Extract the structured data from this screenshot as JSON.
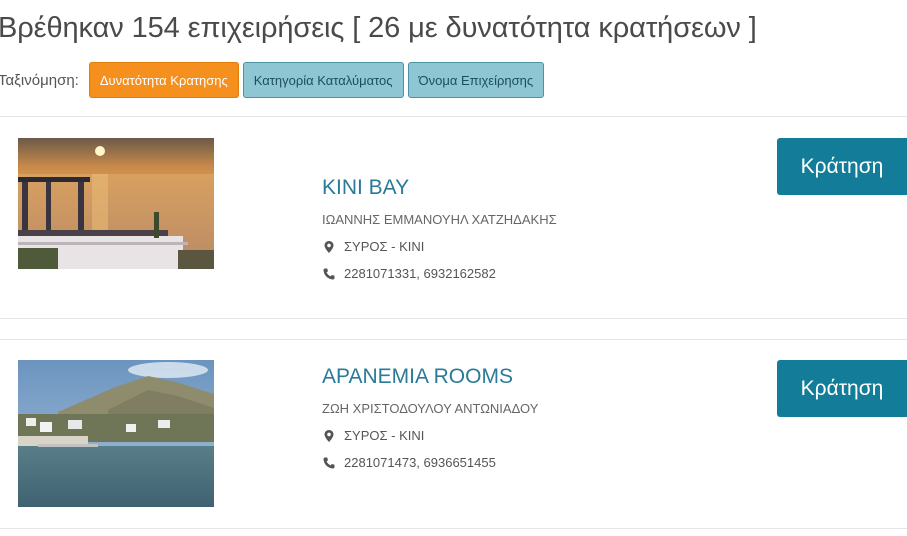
{
  "header": {
    "results_text": "Βρέθηκαν 154 επιχειρήσεις [ 26 με δυνατότητα κρατήσεων ]"
  },
  "sort": {
    "label": "Ταξινόμηση:",
    "options": [
      {
        "label": "Δυνατότητα Κρατησης",
        "active": true
      },
      {
        "label": "Κατηγορία Καταλύματος",
        "active": false
      },
      {
        "label": "Όνομα Επιχείρησης",
        "active": false
      }
    ]
  },
  "listings": [
    {
      "name": "KINI BAY",
      "owner": "ΙΩΑΝΝΗΣ ΕΜΜΑΝΟΥΗΛ ΧΑΤΖΗΔΑΚΗΣ",
      "location": "ΣΥΡΟΣ - ΚΙΝΙ",
      "phones": "2281071331, 6932162582",
      "book_label": "Κράτηση",
      "location_icon": "map-marker-icon",
      "phone_icon": "phone-icon"
    },
    {
      "name": "APANEMIA ROOMS",
      "owner": "ΖΩΗ ΧΡΙΣΤΟΔΟΥΛΟΥ ΑΝΤΩΝΙΑΔΟΥ",
      "location": "ΣΥΡΟΣ - ΚΙΝΙ",
      "phones": "2281071473, 6936651455",
      "book_label": "Κράτηση",
      "location_icon": "map-marker-icon",
      "phone_icon": "phone-icon"
    }
  ],
  "colors": {
    "sort_active": "#f5901e",
    "sort_inactive": "#8fc6d4",
    "book_button": "#137d99",
    "business_name": "#2a7a98"
  }
}
